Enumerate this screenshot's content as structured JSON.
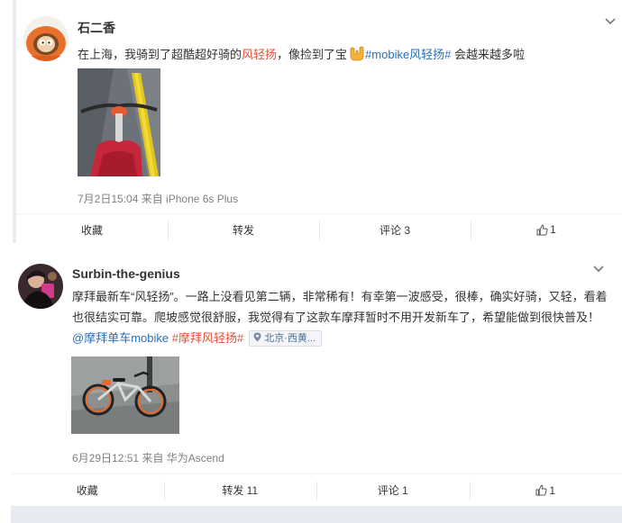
{
  "posts": [
    {
      "username": "石二香",
      "text_prefix": "在上海，我骑到了超酷超好骑的",
      "text_highlight": "风轻扬",
      "text_mid": "，像捡到了宝",
      "hashtag": "#mobike风轻扬#",
      "text_suffix": " 会越来越多啦",
      "meta": "7月2日15:04 来自 iPhone 6s Plus",
      "actions": {
        "favorite": "收藏",
        "repost": "转发",
        "comment": "评论 3",
        "like": "1"
      }
    },
    {
      "username": "Surbin-the-genius",
      "text_body": "摩拜最新车“风轻扬”。一路上没看见第二辆，非常稀有！有幸第一波感受，很棒，确实好骑，又轻，看着也很结实可靠。爬坡感觉很舒服，我觉得有了这款车摩拜暂时不用开发新车了，希望能做到很快普及！",
      "mention": "@摩拜单车mobike",
      "hashtag": "#摩拜风轻扬#",
      "location": "北京·西黄...",
      "meta": "6月29日12:51 来自 华为Ascend",
      "actions": {
        "favorite": "收藏",
        "repost": "转发 11",
        "comment": "评论 1",
        "like": "1"
      }
    }
  ],
  "colors": {
    "highlight_red": "#eb4d38",
    "link_blue": "#2a6fbd",
    "meta_gray": "#808080"
  },
  "icons": [
    "avatar-cartoon",
    "avatar-photo",
    "chevron-down-icon",
    "rock-hand-emoji-icon",
    "location-pin-icon",
    "thumbs-up-icon"
  ]
}
